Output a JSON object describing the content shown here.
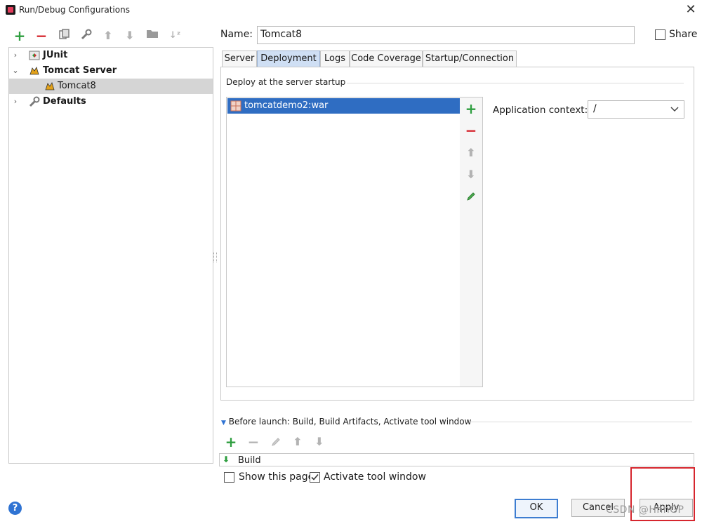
{
  "window": {
    "title": "Run/Debug Configurations"
  },
  "toolbar": {
    "icons": [
      "add-icon",
      "remove-icon",
      "copy-icon",
      "wrench-icon",
      "move-up-icon",
      "move-down-icon",
      "folder-icon",
      "sort-icon"
    ]
  },
  "tree": {
    "items": [
      {
        "label": "JUnit",
        "chevron": "›"
      },
      {
        "label": "Tomcat Server",
        "chevron": "⌄"
      },
      {
        "label": "Tomcat8"
      },
      {
        "label": "Defaults",
        "chevron": "›"
      }
    ]
  },
  "name": {
    "label": "Name:",
    "value": "Tomcat8"
  },
  "share": {
    "label": "Share",
    "checked": false
  },
  "tabs": [
    "Server",
    "Deployment",
    "Logs",
    "Code Coverage",
    "Startup/Connection"
  ],
  "deployment": {
    "section_label": "Deploy at the server startup",
    "artifacts": [
      "tomcatdemo2:war"
    ],
    "context_label": "Application context:",
    "context_value": "/"
  },
  "before_launch": {
    "label": "Before launch: Build, Build Artifacts, Activate tool window",
    "items": [
      "Build"
    ]
  },
  "options": {
    "show_page_label": "Show this page",
    "show_page_checked": false,
    "activate_label": "Activate tool window",
    "activate_checked": true
  },
  "buttons": {
    "ok": "OK",
    "cancel": "Cancel",
    "apply": "Apply",
    "help": "?"
  },
  "watermark": "CSDN @HhhGP",
  "colors": {
    "accent": "#2f6dc2",
    "add": "#2e9e3f",
    "remove": "#d6262e",
    "highlight": "#d6262e"
  }
}
